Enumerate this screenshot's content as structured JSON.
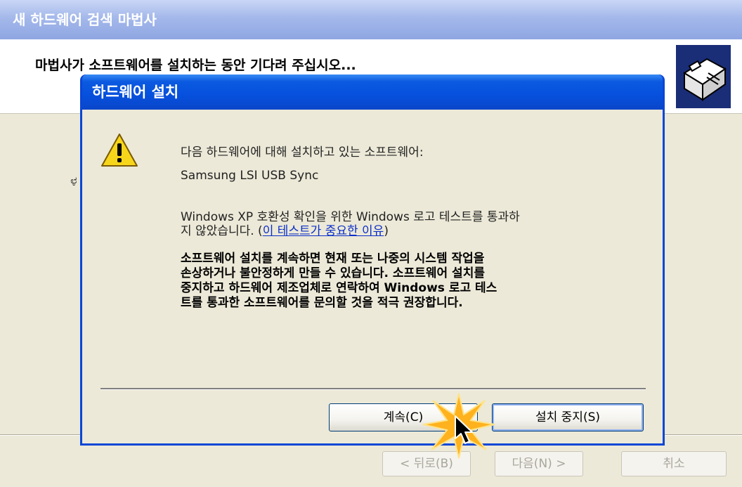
{
  "wizard": {
    "title": "새 하드웨어 검색 마법사",
    "header_text": "마법사가 소프트웨어를 설치하는 동안 기다려 주십시오...",
    "body_fragment": "ಳ",
    "buttons": {
      "back": "< 뒤로(B)",
      "next": "다음(N) >",
      "cancel": "취소"
    }
  },
  "dialog": {
    "title": "하드웨어 설치",
    "intro": "다음 하드웨어에 대해 설치하고 있는 소프트웨어:",
    "device_name": "Samsung LSI USB Sync",
    "logo_test_line1": "Windows XP 호환성 확인을 위한 Windows 로고 테스트를 통과하",
    "logo_test_line2_prefix": "지 않았습니다. (",
    "logo_test_link": "이 테스트가 중요한 이유",
    "logo_test_line2_suffix": ")",
    "warning_lines": [
      "소프트웨어 설치를 계속하면 현재 또는 나중의 시스템 작업을",
      "손상하거나 불안정하게 만들 수 있습니다. 소프트웨어 설치를",
      "중지하고 하드웨어 제조업체로 연락하여 Windows 로고 테스",
      "트를 통과한 소프트웨어를 문의할 것을 적극 권장합니다."
    ],
    "continue_button": "계속(C)",
    "stop_button": "설치 중지(S)"
  },
  "icons": {
    "warning": "warning-triangle-icon",
    "hardware": "hardware-wizard-icon",
    "cursor": "mouse-pointer-icon"
  },
  "colors": {
    "titlebar_blue": "#0650dd",
    "dialog_bg": "#ece9d8",
    "link": "#0b2fc9"
  }
}
